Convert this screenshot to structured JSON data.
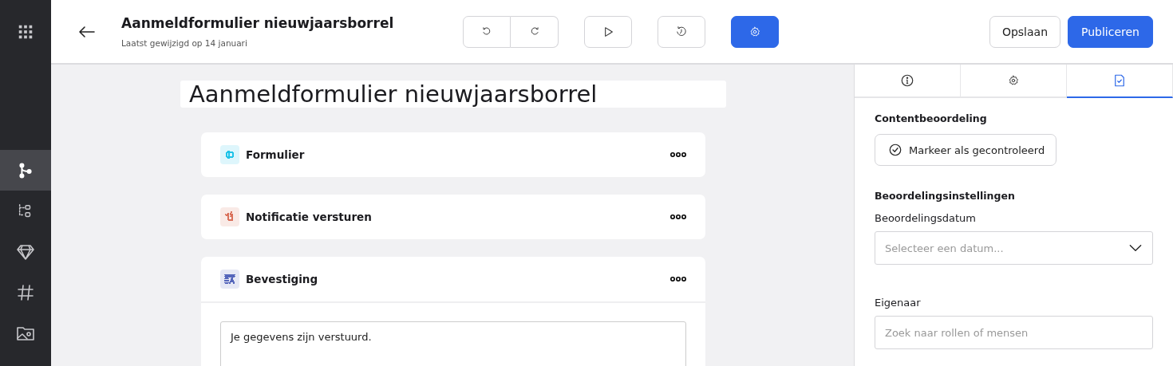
{
  "sidebar": {
    "items": [
      {
        "kind": "apps",
        "selected": false
      },
      {
        "kind": "flow",
        "selected": true
      },
      {
        "kind": "structure",
        "selected": false
      },
      {
        "kind": "gem",
        "selected": false
      },
      {
        "kind": "hash",
        "selected": false
      },
      {
        "kind": "media",
        "selected": false
      }
    ]
  },
  "header": {
    "title": "Aanmeldformulier nieuwjaarsborrel",
    "subtitle": "Laatst gewijzigd op 14 januari",
    "tools": [
      {
        "kind": "undo",
        "selected": false
      },
      {
        "kind": "redo",
        "selected": false
      },
      {
        "kind": "play",
        "selected": false
      },
      {
        "kind": "history",
        "selected": false
      },
      {
        "kind": "settings",
        "selected": true
      }
    ],
    "buttons": [
      {
        "label": "Opslaan",
        "kind": "secondary"
      },
      {
        "label": "Publiceren",
        "kind": "primary"
      }
    ]
  },
  "canvas": {
    "page_title": "Aanmeldformulier nieuwjaarsborrel",
    "blocks": [
      {
        "title": "Formulier",
        "kind": "form",
        "color": "#1fc3e8",
        "expanded": false
      },
      {
        "title": "Notificatie versturen",
        "kind": "notify",
        "color": "#d9705a",
        "expanded": false
      },
      {
        "title": "Bevestiging",
        "kind": "text",
        "color": "#5566bb",
        "expanded": true,
        "value": "Je gegevens zijn verstuurd."
      }
    ]
  },
  "panel": {
    "tabs": [
      {
        "kind": "info",
        "selected": false
      },
      {
        "kind": "settings",
        "selected": false
      },
      {
        "kind": "review",
        "selected": true
      }
    ],
    "section_title": "Contentbeoordeling",
    "review_button": "Markeer als gecontroleerd",
    "settings_title": "Beoordelingsinstellingen",
    "date_label": "Beoordelingsdatum",
    "date_placeholder": "Selecteer een datum...",
    "owner_label": "Eigenaar",
    "owner_placeholder": "Zoek naar rollen of mensen"
  }
}
